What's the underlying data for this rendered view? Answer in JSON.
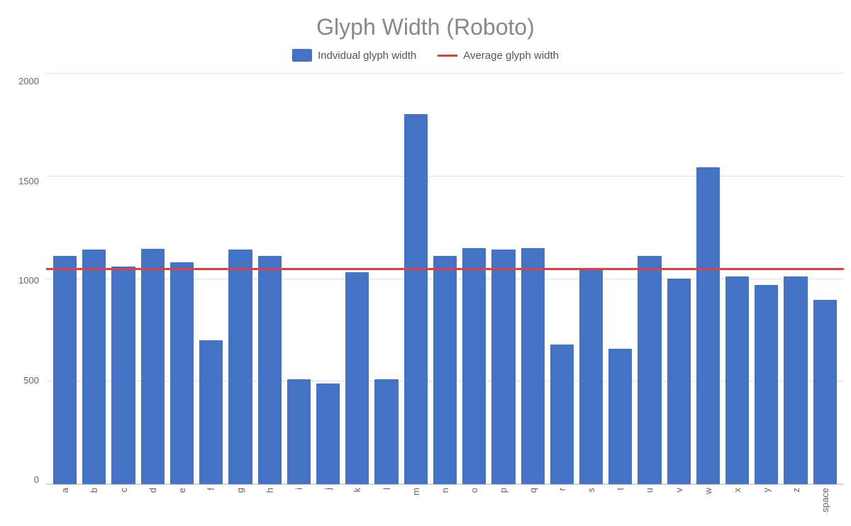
{
  "title": "Glyph Width (Roboto)",
  "legend": {
    "bar_label": "Indvidual glyph width",
    "line_label": "Average glyph width"
  },
  "y_axis": {
    "labels": [
      "2000",
      "1500",
      "1000",
      "500",
      "0"
    ]
  },
  "average_value": 1040,
  "max_value": 2000,
  "bars": [
    {
      "label": "a",
      "value": 1110
    },
    {
      "label": "b",
      "value": 1140
    },
    {
      "label": "c",
      "value": 1060
    },
    {
      "label": "d",
      "value": 1145
    },
    {
      "label": "e",
      "value": 1080
    },
    {
      "label": "f",
      "value": 700
    },
    {
      "label": "g",
      "value": 1140
    },
    {
      "label": "h",
      "value": 1110
    },
    {
      "label": "i",
      "value": 510
    },
    {
      "label": "j",
      "value": 490
    },
    {
      "label": "k",
      "value": 1030
    },
    {
      "label": "l",
      "value": 510
    },
    {
      "label": "m",
      "value": 1800
    },
    {
      "label": "n",
      "value": 1110
    },
    {
      "label": "o",
      "value": 1150
    },
    {
      "label": "p",
      "value": 1140
    },
    {
      "label": "q",
      "value": 1150
    },
    {
      "label": "r",
      "value": 680
    },
    {
      "label": "s",
      "value": 1050
    },
    {
      "label": "t",
      "value": 660
    },
    {
      "label": "u",
      "value": 1110
    },
    {
      "label": "v",
      "value": 1000
    },
    {
      "label": "w",
      "value": 1540
    },
    {
      "label": "x",
      "value": 1010
    },
    {
      "label": "y",
      "value": 970
    },
    {
      "label": "z",
      "value": 1010
    },
    {
      "label": "space",
      "value": 895
    }
  ],
  "colors": {
    "bar": "#4472c4",
    "avg_line": "#e04040",
    "grid": "#e0e0e0",
    "title": "#888888",
    "axis_text": "#666666"
  }
}
